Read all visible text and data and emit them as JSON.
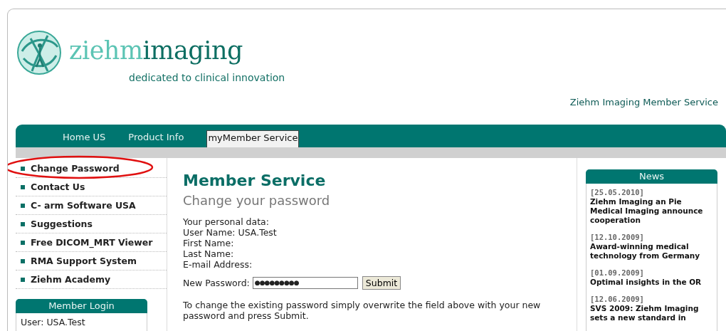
{
  "logo": {
    "brand_light": "ziehm",
    "brand_dark": "imaging",
    "tagline": "dedicated to clinical innovation"
  },
  "header_link": "Ziehm Imaging Member Service",
  "tabs": [
    {
      "label": "Home US",
      "selected": false
    },
    {
      "label": "Product Info",
      "selected": false
    },
    {
      "label": "myMember Service",
      "selected": true
    }
  ],
  "sidebar": {
    "items": [
      {
        "label": "Change Password",
        "circled": true
      },
      {
        "label": "Contact Us",
        "circled": false
      },
      {
        "label": "C- arm Software USA",
        "circled": false
      },
      {
        "label": "Suggestions",
        "circled": false
      },
      {
        "label": "Free DICOM_MRT Viewer",
        "circled": false
      },
      {
        "label": "RMA Support System",
        "circled": false
      },
      {
        "label": "Ziehm Academy",
        "circled": false
      }
    ],
    "login": {
      "title": "Member Login",
      "user": "User: USA.Test"
    }
  },
  "main": {
    "title": "Member Service",
    "subtitle": "Change your password",
    "personal_data": [
      "Your personal data:",
      "User Name: USA.Test",
      "First Name:",
      "Last Name:",
      "E-mail Address:"
    ],
    "password_label": "New Password:",
    "password_value": "●●●●●●●●●",
    "submit": "Submit",
    "hint": "To change the existing password simply overwrite the field above with your new password and press Submit."
  },
  "news": {
    "title": "News",
    "items": [
      {
        "date": "[25.05.2010]",
        "headline": "Ziehm Imaging an Pie Medical Imaging announce cooperation"
      },
      {
        "date": "[12.10.2009]",
        "headline": "Award-winning medical technology from Germany"
      },
      {
        "date": "[01.09.2009]",
        "headline": "Optimal insights in the OR"
      },
      {
        "date": "[12.06.2009]",
        "headline": "SVS 2009: Ziehm Imaging sets a new standard in"
      }
    ]
  }
}
